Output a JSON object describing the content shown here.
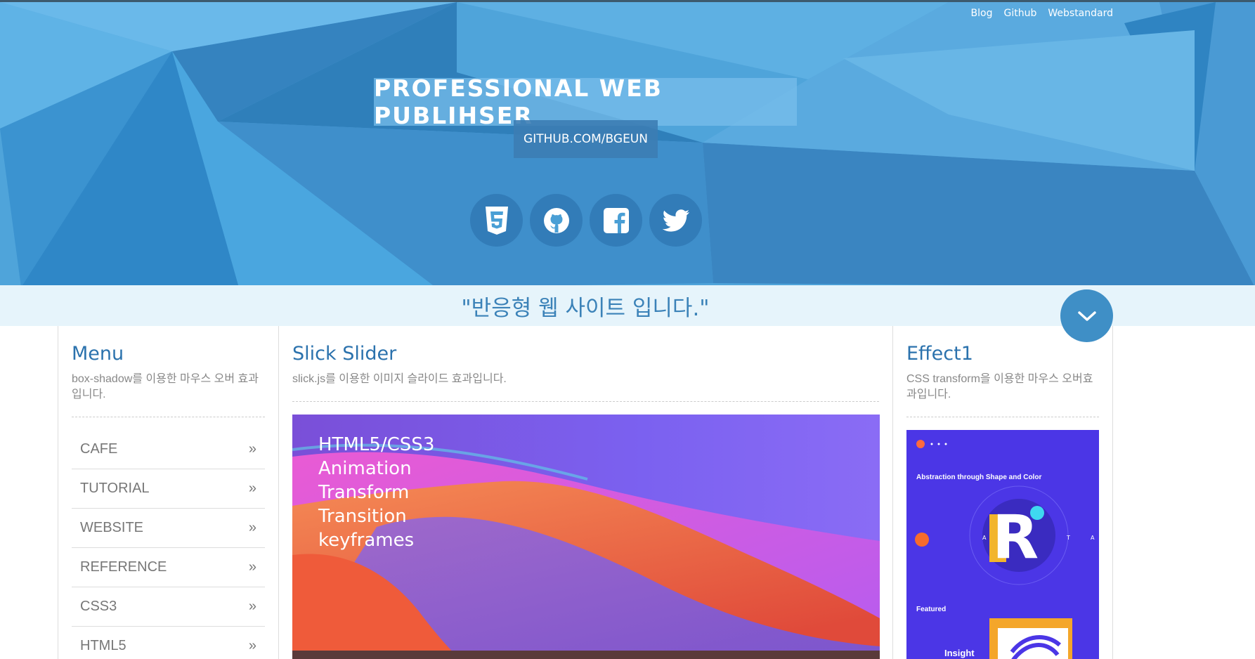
{
  "header": {
    "nav": [
      "Blog",
      "Github",
      "Webstandard"
    ],
    "title": "PROFESSIONAL WEB PUBLIHSER",
    "subtitle": "GITHUB.COM/BGEUN",
    "social_icons": [
      "html5-icon",
      "github-icon",
      "facebook-icon",
      "twitter-icon"
    ]
  },
  "tagline": "\"반응형 웹 사이트 입니다.\"",
  "menu": {
    "title": "Menu",
    "desc": "box-shadow를 이용한 마우스 오버 효과입니다.",
    "items": [
      "CAFE",
      "TUTORIAL",
      "WEBSITE",
      "REFERENCE",
      "CSS3",
      "HTML5"
    ]
  },
  "slider": {
    "title": "Slick Slider",
    "desc": "slick.js를 이용한 이미지 슬라이드 효과입니다.",
    "lines": [
      "HTML5/CSS3",
      "Animation",
      "Transform",
      "Transition",
      "keyframes"
    ]
  },
  "effect": {
    "title": "Effect1",
    "desc": "CSS transform을 이용한 마우스 오버효과입니다.",
    "card_heading": "Abstraction through Shape and Color",
    "card_featured": "Featured",
    "card_insight": "Insight"
  },
  "colors": {
    "header_bg": "#4a9fd5",
    "tagline_text": "#3b82b8",
    "heading": "#2b72ad",
    "down_button": "#3f8fc6"
  }
}
